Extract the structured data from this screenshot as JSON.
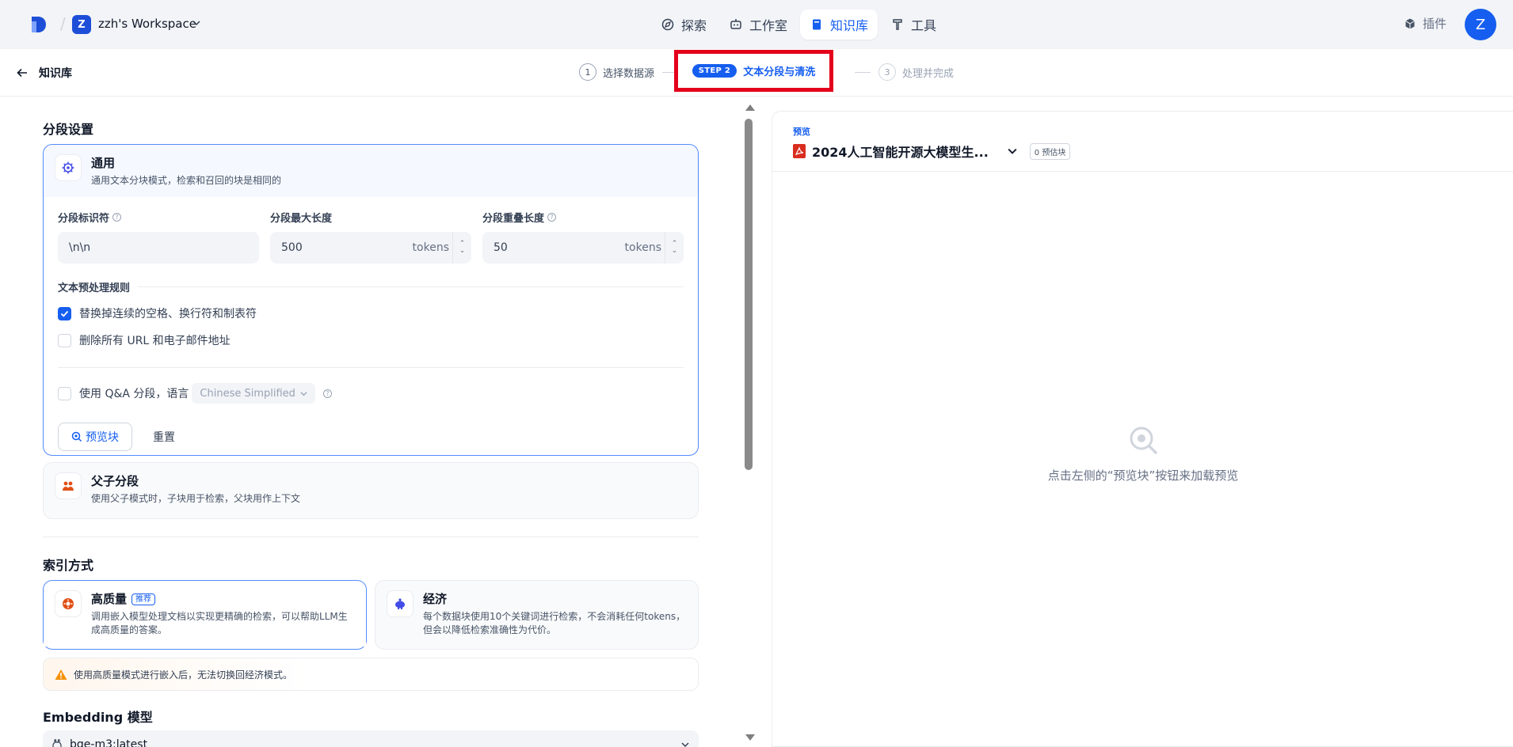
{
  "topbar": {
    "workspace_initial": "Z",
    "workspace_name": "zzh's Workspace",
    "nav": [
      {
        "label": "探索",
        "icon": "compass-icon"
      },
      {
        "label": "工作室",
        "icon": "robot-icon"
      },
      {
        "label": "知识库",
        "icon": "book-icon",
        "active": true
      },
      {
        "label": "工具",
        "icon": "hammer-icon"
      }
    ],
    "plugins_label": "插件",
    "user_initial": "Z"
  },
  "subheader": {
    "back_label": "知识库",
    "steps": [
      {
        "num": "1",
        "label": "选择数据源"
      },
      {
        "pill": "STEP 2",
        "label": "文本分段与清洗"
      },
      {
        "num": "3",
        "label": "处理并完成"
      }
    ]
  },
  "segment": {
    "title": "分段设置",
    "general": {
      "title": "通用",
      "desc": "通用文本分块模式，检索和召回的块是相同的",
      "fields": [
        {
          "label": "分段标识符",
          "value": "\\n\\n",
          "has_help": true
        },
        {
          "label": "分段最大长度",
          "value": "500",
          "unit": "tokens"
        },
        {
          "label": "分段重叠长度",
          "value": "50",
          "unit": "tokens",
          "has_help": true
        }
      ],
      "rules_title": "文本预处理规则",
      "rules": [
        {
          "label": "替换掉连续的空格、换行符和制表符",
          "checked": true
        },
        {
          "label": "删除所有 URL 和电子邮件地址",
          "checked": false
        }
      ],
      "qa_label": "使用 Q&A 分段，语言",
      "qa_language": "Chinese Simplified",
      "preview_button": "预览块",
      "reset_button": "重置"
    },
    "parent_child": {
      "title": "父子分段",
      "desc": "使用父子模式时，子块用于检索，父块用作上下文"
    }
  },
  "index": {
    "title": "索引方式",
    "high_quality": {
      "title": "高质量",
      "badge": "推荐",
      "desc": "调用嵌入模型处理文档以实现更精确的检索，可以帮助LLM生成高质量的答案。"
    },
    "economy": {
      "title": "经济",
      "desc": "每个数据块使用10个关键词进行检索，不会消耗任何tokens，但会以降低检索准确性为代价。"
    },
    "warning": "使用高质量模式进行嵌入后，无法切换回经济模式。"
  },
  "embedding": {
    "title": "Embedding 模型",
    "model": "bge-m3:latest"
  },
  "preview": {
    "tag": "预览",
    "doc_name": "2024人工智能开源大模型生...",
    "chip": "0 预估块",
    "empty_text": "点击左侧的“预览块”按钮来加载预览"
  },
  "colors": {
    "accent": "#155eef",
    "highlight_box": "#e4001b",
    "warning": "#f79009",
    "pdf_red": "#d92d20",
    "orange_icon": "#e04f16"
  }
}
